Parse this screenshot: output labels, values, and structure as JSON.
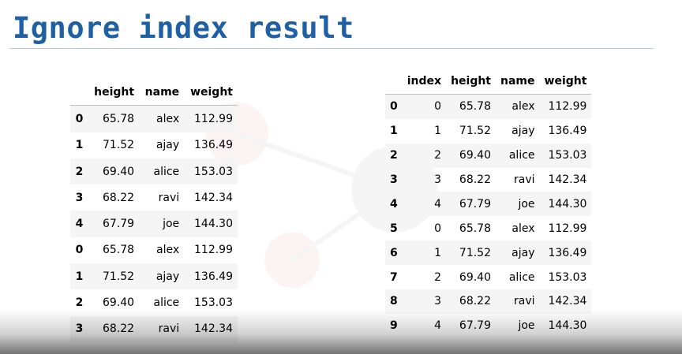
{
  "slide": {
    "title": "Ignore index result"
  },
  "left_table": {
    "columns": [
      "",
      "height",
      "name",
      "weight"
    ],
    "rows": [
      [
        "0",
        "65.78",
        "alex",
        "112.99"
      ],
      [
        "1",
        "71.52",
        "ajay",
        "136.49"
      ],
      [
        "2",
        "69.40",
        "alice",
        "153.03"
      ],
      [
        "3",
        "68.22",
        "ravi",
        "142.34"
      ],
      [
        "4",
        "67.79",
        "joe",
        "144.30"
      ],
      [
        "0",
        "65.78",
        "alex",
        "112.99"
      ],
      [
        "1",
        "71.52",
        "ajay",
        "136.49"
      ],
      [
        "2",
        "69.40",
        "alice",
        "153.03"
      ],
      [
        "3",
        "68.22",
        "ravi",
        "142.34"
      ]
    ]
  },
  "right_table": {
    "columns": [
      "",
      "index",
      "height",
      "name",
      "weight"
    ],
    "rows": [
      [
        "0",
        "0",
        "65.78",
        "alex",
        "112.99"
      ],
      [
        "1",
        "1",
        "71.52",
        "ajay",
        "136.49"
      ],
      [
        "2",
        "2",
        "69.40",
        "alice",
        "153.03"
      ],
      [
        "3",
        "3",
        "68.22",
        "ravi",
        "142.34"
      ],
      [
        "4",
        "4",
        "67.79",
        "joe",
        "144.30"
      ],
      [
        "5",
        "0",
        "65.78",
        "alex",
        "112.99"
      ],
      [
        "6",
        "1",
        "71.52",
        "ajay",
        "136.49"
      ],
      [
        "7",
        "2",
        "69.40",
        "alice",
        "153.03"
      ],
      [
        "8",
        "3",
        "68.22",
        "ravi",
        "142.34"
      ],
      [
        "9",
        "4",
        "67.79",
        "joe",
        "144.30"
      ]
    ]
  },
  "colors": {
    "title": "#1f5fa3",
    "row_stripe": "#f5f5f5",
    "rule": "#b7cbe3"
  }
}
